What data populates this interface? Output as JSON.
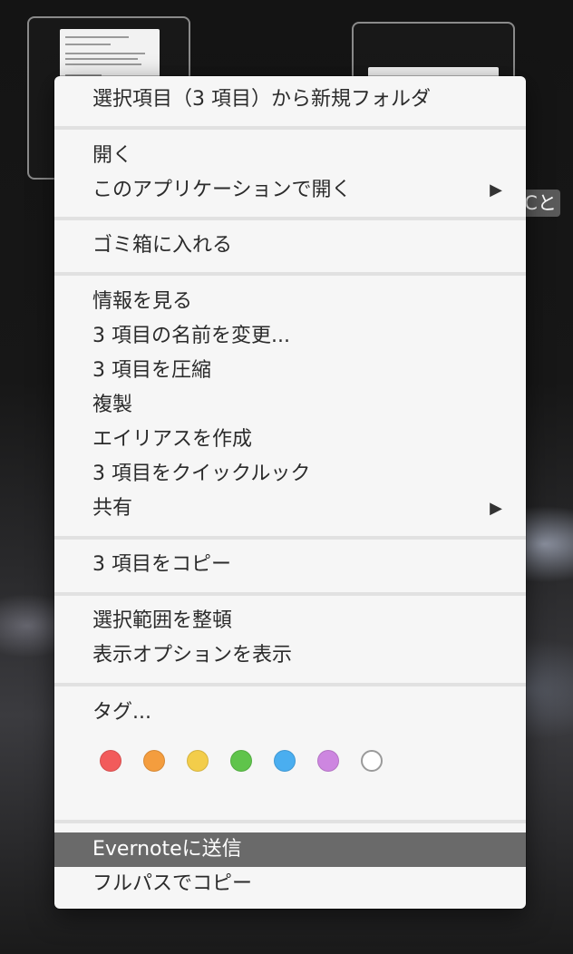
{
  "badge": {
    "text": "Cと"
  },
  "menu": {
    "new_folder": "選択項目（3 項目）から新規フォルダ",
    "open": "開く",
    "open_with": "このアプリケーションで開く",
    "trash": "ゴミ箱に入れる",
    "get_info": "情報を見る",
    "rename": "3 項目の名前を変更...",
    "compress": "3 項目を圧縮",
    "duplicate": "複製",
    "make_alias": "エイリアスを作成",
    "quick_look": "3 項目をクイックルック",
    "share": "共有",
    "copy": "3 項目をコピー",
    "clean_up": "選択範囲を整頓",
    "view_options": "表示オプションを表示",
    "tags": "タグ...",
    "evernote": "Evernoteに送信",
    "copy_path": "フルパスでコピー",
    "submenu_arrow": "▶"
  },
  "tag_colors": [
    {
      "name": "red",
      "color": "#f25b5b"
    },
    {
      "name": "orange",
      "color": "#f49d3e"
    },
    {
      "name": "yellow",
      "color": "#f3cd4a"
    },
    {
      "name": "green",
      "color": "#5fc44b"
    },
    {
      "name": "blue",
      "color": "#4aaef0"
    },
    {
      "name": "purple",
      "color": "#cd86e0"
    },
    {
      "name": "gray",
      "color": "#ffffff"
    }
  ]
}
